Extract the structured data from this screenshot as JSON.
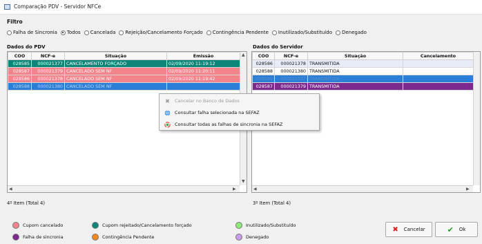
{
  "window": {
    "title": "Comparação PDV - Servidor NFCe"
  },
  "filter": {
    "label": "Filtro",
    "options": [
      {
        "label": "Falha de Sincronia",
        "selected": false
      },
      {
        "label": "Todos",
        "selected": true
      },
      {
        "label": "Cancelada",
        "selected": false
      },
      {
        "label": "Rejeição/Cancelamento Forçado",
        "selected": false
      },
      {
        "label": "Contingência Pendente",
        "selected": false
      },
      {
        "label": "Inutilizado/Substituído",
        "selected": false
      },
      {
        "label": "Denegado",
        "selected": false
      }
    ]
  },
  "pdv": {
    "title": "Dados do PDV",
    "columns": [
      "COO",
      "NCF-e",
      "Situação",
      "Emissão"
    ],
    "rows": [
      {
        "coo": "028585",
        "ncfe": "000021377",
        "situacao": "CANCELAMENTO FORÇADO",
        "emissao": "02/09/2020 11:19:12",
        "bg": "#0d8578",
        "fg": "#ffffff"
      },
      {
        "coo": "028587",
        "ncfe": "000021379",
        "situacao": "CANCELADO SEM NF",
        "emissao": "02/09/2020 11:20:11",
        "bg": "#f4848c",
        "fg": "#ffffff"
      },
      {
        "coo": "028586",
        "ncfe": "000021378",
        "situacao": "CANCELADO SEM NF",
        "emissao": "02/09/2020 11:19:42",
        "bg": "#f4848c",
        "fg": "#ffffff"
      },
      {
        "coo": "028588",
        "ncfe": "000021380",
        "situacao": "CANCELADO SEM NF",
        "emissao": "",
        "bg": "#2c7fd6",
        "fg": "#b9d3f0"
      }
    ],
    "status": "4º Item (Total 4)"
  },
  "servidor": {
    "title": "Dados do Servidor",
    "columns": [
      "COO",
      "NCF-e",
      "Situação",
      "Cancelamento"
    ],
    "rows": [
      {
        "coo": "028586",
        "ncfe": "000021378",
        "situacao": "TRANSMITIDA",
        "cancelamento": "",
        "bg": "#e8ecf9",
        "fg": "#111111"
      },
      {
        "coo": "028588",
        "ncfe": "000021380",
        "situacao": "TRANSMITIDA",
        "cancelamento": "",
        "bg": "#ffffff",
        "fg": "#111111"
      },
      {
        "coo": "028585",
        "ncfe": "000021377",
        "situacao": "TRANSMITIDA",
        "cancelamento": "",
        "bg": "#2c7fd6",
        "fg": "#5b8fcb"
      },
      {
        "coo": "028587",
        "ncfe": "000021379",
        "situacao": "TRANSMITIDA",
        "cancelamento": "",
        "bg": "#7d2a8f",
        "fg": "#ffffff"
      }
    ],
    "status": "3º Item (Total 4)"
  },
  "context_menu": {
    "items": [
      {
        "label": "Cancelar no Banco de Dados",
        "icon": "cancel-x-icon",
        "enabled": false
      },
      {
        "label": "Consultar falha selecionada na SEFAZ",
        "icon": "globe-icon",
        "enabled": true
      },
      {
        "label": "Consultar todas as falhas de sincronia na SEFAZ",
        "icon": "refresh-globe-icon",
        "enabled": true
      }
    ]
  },
  "legend": [
    {
      "label": "Cupom cancelado",
      "color": "#f4848c"
    },
    {
      "label": "Cupom rejeitado/Cancelamento forçado",
      "color": "#0d8578"
    },
    {
      "label": "Inutilizado/Substituído",
      "color": "#8ee87a"
    },
    {
      "label": "Falha de sincronia",
      "color": "#7d2a8f"
    },
    {
      "label": "Contingência Pendente",
      "color": "#f08a1e"
    },
    {
      "label": "Denegado",
      "color": "#c79be8"
    }
  ],
  "buttons": {
    "cancel": "Cancelar",
    "ok": "Ok"
  }
}
